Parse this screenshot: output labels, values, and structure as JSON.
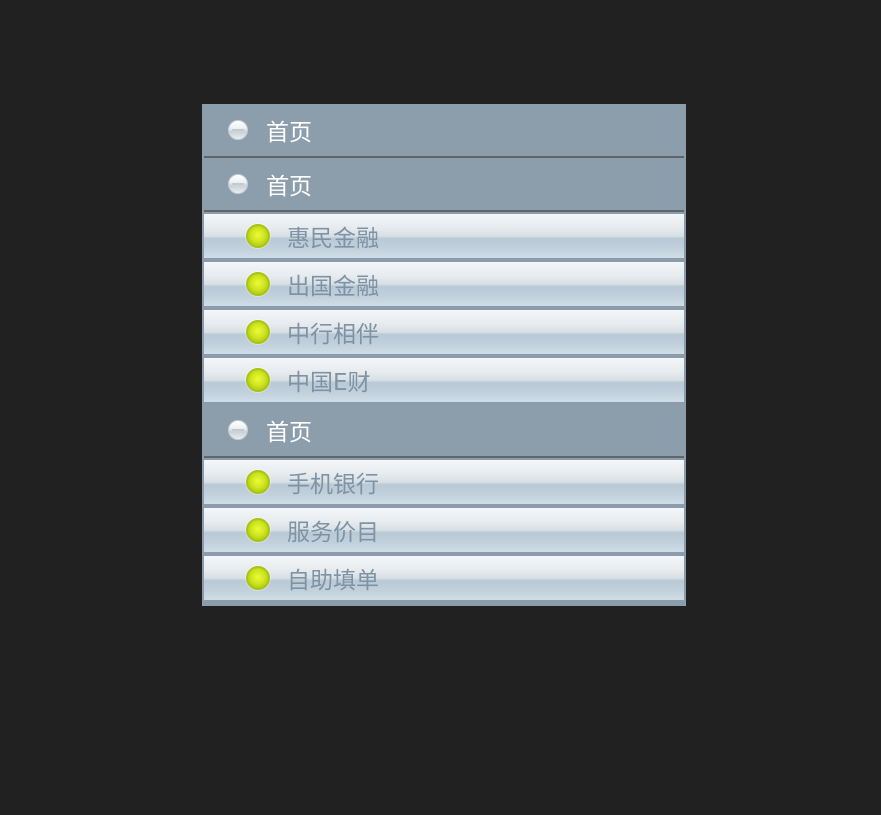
{
  "menu": {
    "groups": [
      {
        "title": "首页"
      },
      {
        "title": "首页",
        "items": [
          "惠民金融",
          "出国金融",
          "中行相伴",
          "中国E财"
        ]
      },
      {
        "title": "首页",
        "items": [
          "手机银行",
          "服务价目",
          "自助填单"
        ]
      }
    ]
  },
  "colors": {
    "page_background": "#212121",
    "header_background": "#8c9dab",
    "header_text": "#ffffff",
    "item_text": "#7f93a5",
    "bullet_green": "#cfe61d"
  },
  "icons": {
    "header_icon": "collapse-circle-icon",
    "item_icon": "green-bullet-icon"
  }
}
